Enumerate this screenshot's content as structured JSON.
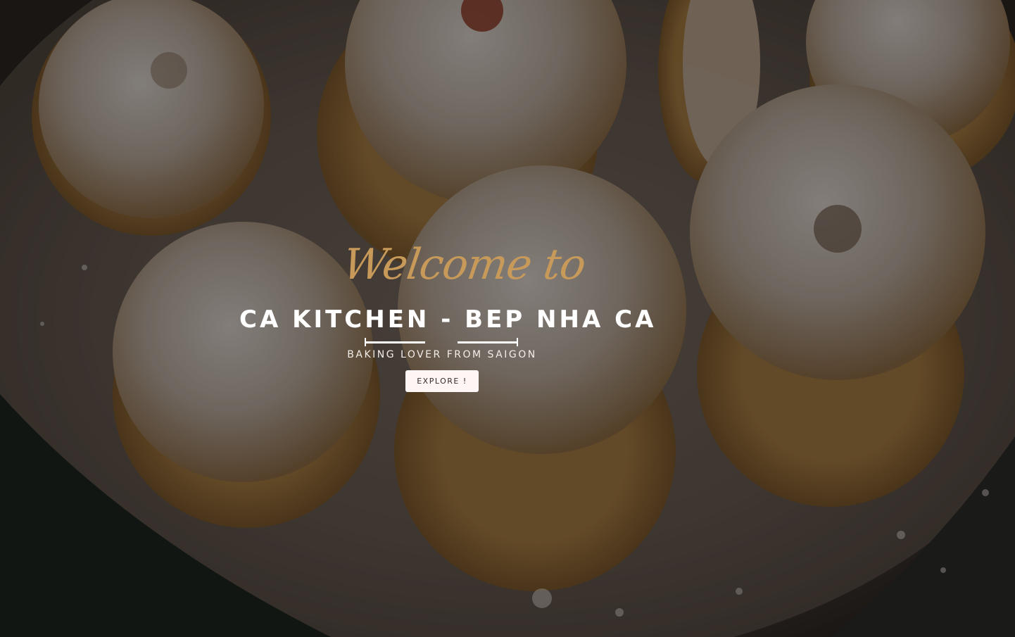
{
  "hero": {
    "welcome_text": "Welcome to",
    "title": "CA KITCHEN - BEP NHA CA",
    "tagline": "BAKING LOVER FROM SAIGON",
    "cta_label": "EXPLORE !",
    "background_image_alt": "sugar-dusted flower cookies"
  },
  "colors": {
    "accent_gold": "#c89a5a",
    "title_white": "#ffffff",
    "button_bg": "#fdf6f4",
    "button_text": "#3a2d28"
  }
}
